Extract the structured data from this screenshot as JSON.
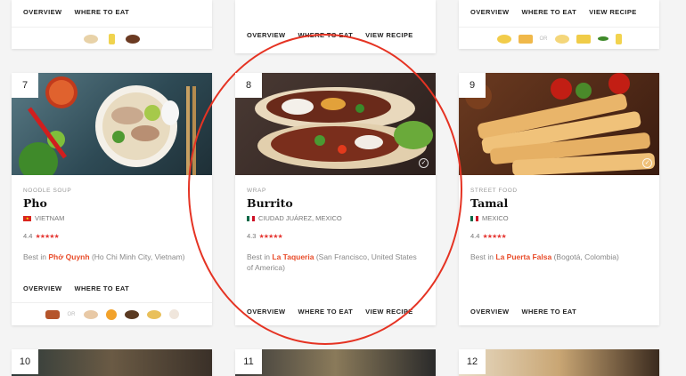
{
  "top_row": [
    {
      "links": [
        "OVERVIEW",
        "WHERE TO EAT"
      ]
    },
    {
      "links": [
        "OVERVIEW",
        "WHERE TO EAT",
        "VIEW RECIPE"
      ]
    },
    {
      "links": [
        "OVERVIEW",
        "WHERE TO EAT",
        "VIEW RECIPE"
      ]
    }
  ],
  "cards": [
    {
      "rank": "7",
      "category": "NOODLE SOUP",
      "name": "Pho",
      "origin": "VIETNAM",
      "rating": "4.4",
      "stars": "★★★★★",
      "best_prefix": "Best in",
      "best_place": "Phở Quynh",
      "best_suffix": "(Ho Chi Minh City, Vietnam)",
      "links": [
        "OVERVIEW",
        "WHERE TO EAT"
      ],
      "or_separator": "OR",
      "flag_colors": [
        "#da251d",
        "#ffff00"
      ],
      "image_colors": [
        "#5a7b86",
        "#2e4a55"
      ]
    },
    {
      "rank": "8",
      "category": "WRAP",
      "name": "Burrito",
      "origin": "CIUDAD JUÁREZ, MEXICO",
      "rating": "4.3",
      "stars": "★★★★★",
      "best_prefix": "Best in",
      "best_place": "La Taqueria",
      "best_suffix": "(San Francisco, United States of America)",
      "links": [
        "OVERVIEW",
        "WHERE TO EAT",
        "VIEW RECIPE"
      ],
      "flag_colors": [
        "#006847",
        "#ce1126"
      ],
      "image_colors": [
        "#4a3a34",
        "#2b1f1c"
      ],
      "check": "✓"
    },
    {
      "rank": "9",
      "category": "STREET FOOD",
      "name": "Tamal",
      "origin": "MEXICO",
      "rating": "4.4",
      "stars": "★★★★★",
      "best_prefix": "Best in",
      "best_place": "La Puerta Falsa",
      "best_suffix": "(Bogotá, Colombia)",
      "links": [
        "OVERVIEW",
        "WHERE TO EAT"
      ],
      "flag_colors": [
        "#006847",
        "#ce1126"
      ],
      "image_colors": [
        "#6b3a20",
        "#3a1c10"
      ],
      "check": "✓"
    }
  ],
  "bottom_row": [
    {
      "rank": "10"
    },
    {
      "rank": "11"
    },
    {
      "rank": "12"
    }
  ],
  "accent_color": "#e84c2a",
  "annotation_color": "#e53323"
}
